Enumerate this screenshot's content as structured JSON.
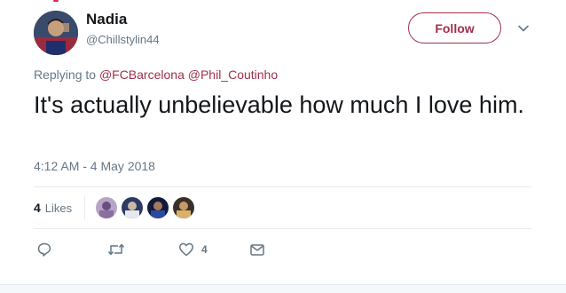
{
  "author": {
    "name": "Nadia",
    "handle": "@Chillstylin44"
  },
  "follow_button": {
    "label": "Follow"
  },
  "reply_context": {
    "prefix": "Replying to",
    "mentions": [
      "@FCBarcelona",
      "@Phil_Coutinho"
    ]
  },
  "tweet": {
    "text": "It's actually unbelievable how much I love him.",
    "timestamp": "4:12 AM - 4 May 2018"
  },
  "stats": {
    "likes_count": "4",
    "likes_label": "Likes"
  },
  "actions": {
    "reply_icon": "reply-icon",
    "retweet_icon": "retweet-icon",
    "like_icon": "heart-icon",
    "like_count": "4",
    "dm_icon": "envelope-icon"
  },
  "colors": {
    "accent": "#a0314b",
    "secondary_text": "#657786",
    "primary_text": "#14171a",
    "divider": "#e6ecf0"
  }
}
